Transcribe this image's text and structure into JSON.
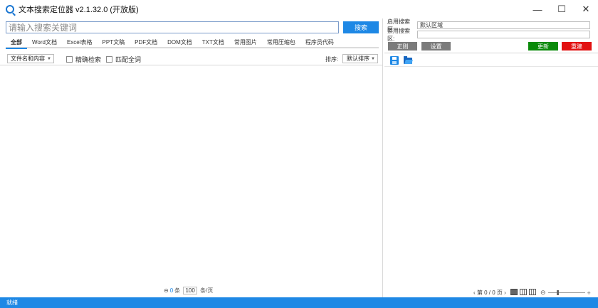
{
  "window": {
    "title": "文本搜索定位器 v2.1.32.0 (开放版)",
    "minimize": "—",
    "maximize": "☐",
    "close": "✕"
  },
  "search": {
    "placeholder": "请输入搜索关键词",
    "value": "",
    "button": "搜索"
  },
  "tabs": [
    {
      "label": "全部",
      "active": true
    },
    {
      "label": "Word文档"
    },
    {
      "label": "Excel表格"
    },
    {
      "label": "PPT文稿"
    },
    {
      "label": "PDF文档"
    },
    {
      "label": "DOM文档"
    },
    {
      "label": "TXT文档"
    },
    {
      "label": "常用图片"
    },
    {
      "label": "常用压缩包"
    },
    {
      "label": "程序员代码"
    }
  ],
  "filters": {
    "mode": "文件名和内容",
    "exact": "精确检索",
    "whole_word": "匹配全词",
    "sort_label": "排序:",
    "sort_value": "默认排序"
  },
  "pager": {
    "prefix": "⊖",
    "count": "0",
    "unit": "条",
    "per_page": "100",
    "per_page_unit": "条/页"
  },
  "right": {
    "enabled_label": "启用搜索区:",
    "enabled_value": "默认区域",
    "disabled_label": "禁用搜索区:",
    "disabled_value": "",
    "btn_regex": "正则",
    "btn_settings": "设置",
    "btn_update": "更新",
    "btn_rebuild": "重建",
    "page_info": "‹ 第 0 / 0 页 ›"
  },
  "status": {
    "text": "就绪"
  },
  "colors": {
    "accent": "#1e88e5",
    "update": "#0a8a0a",
    "rebuild": "#e21111",
    "neutral_btn": "#7b7b7b"
  }
}
